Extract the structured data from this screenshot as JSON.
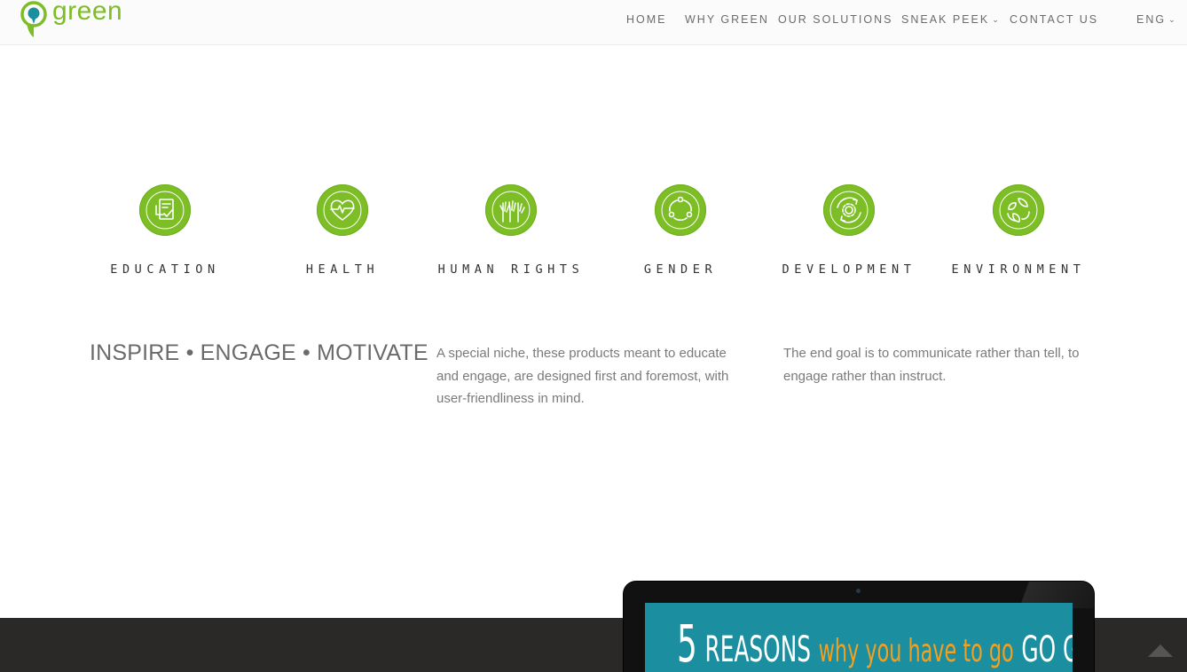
{
  "brand": {
    "name": "green",
    "color": "#7dbd26",
    "logo_icon": "location-pin-icon"
  },
  "nav": {
    "items": [
      {
        "label": "HOME"
      },
      {
        "label": "WHY GREEN"
      },
      {
        "label": "OUR SOLUTIONS"
      },
      {
        "label": "SNEAK PEEK",
        "dropdown": true
      },
      {
        "label": "CONTACT US"
      }
    ],
    "language": {
      "label": "ENG",
      "dropdown": true
    },
    "dropdown_icon": "chevron-down-icon"
  },
  "categories": [
    {
      "label": "EDUCATION",
      "icon": "checklist-icon"
    },
    {
      "label": "HEALTH",
      "icon": "heart-pulse-icon"
    },
    {
      "label": "HUMAN RIGHTS",
      "icon": "raised-hands-icon"
    },
    {
      "label": "GENDER",
      "icon": "people-cycle-icon"
    },
    {
      "label": "DEVELOPMENT",
      "icon": "gear-cycle-icon"
    },
    {
      "label": "ENVIRONMENT",
      "icon": "leaves-recycle-icon"
    }
  ],
  "intro": {
    "tagline": "INSPIRE • ENGAGE • MOTIVATE",
    "paragraph_1": "A special niche, these products meant to educate and engage, are designed first and foremost, with user-friendliness in mind.",
    "paragraph_2": "The end goal is to communicate rather than tell, to engage rather than instruct."
  },
  "promo": {
    "number": "5",
    "word_1": "REASONS",
    "word_2": "why you have to go",
    "word_3": "GO GREEN",
    "screen_color": "#1b8fa0",
    "highlight_color": "#f2a022"
  },
  "footer": {
    "band_color": "#2b2828",
    "back_to_top_icon": "arrow-up-icon"
  }
}
